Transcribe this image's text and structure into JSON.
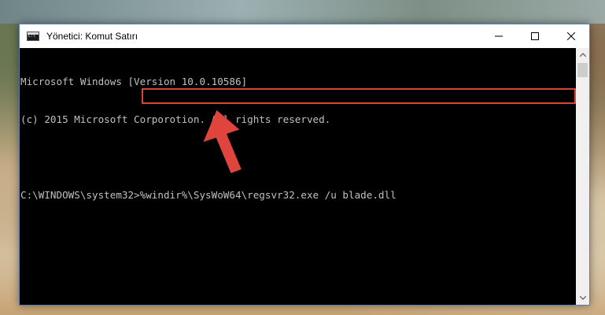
{
  "window": {
    "title": "Yönetici: Komut Satırı",
    "controls": {
      "minimize": "minimize",
      "maximize": "maximize",
      "close": "close"
    }
  },
  "console": {
    "lines": [
      "Microsoft Windows [Version 10.0.10586]",
      "(c) 2015 Microsoft Corporotion. All rights reserved.",
      "",
      "C:\\WINDOWS\\system32>%windir%\\SysWoW64\\regsvr32.exe /u blade.dll"
    ]
  },
  "colors": {
    "highlight": "#d8443c",
    "arrow": "#e0453d",
    "console_text": "#c0c0c0",
    "console_bg": "#000000"
  }
}
